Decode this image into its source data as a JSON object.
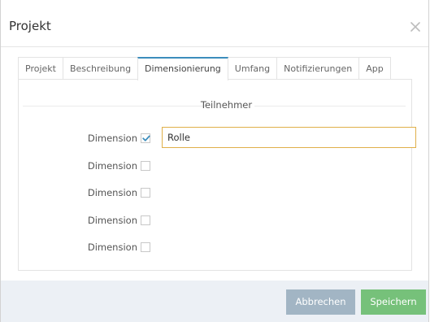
{
  "dialog": {
    "title": "Projekt",
    "close_icon": "close-icon"
  },
  "tabs": [
    {
      "label": "Projekt",
      "active": false
    },
    {
      "label": "Beschreibung",
      "active": false
    },
    {
      "label": "Dimensionierung",
      "active": true
    },
    {
      "label": "Umfang",
      "active": false
    },
    {
      "label": "Notifizierungen",
      "active": false
    },
    {
      "label": "App",
      "active": false
    }
  ],
  "section": {
    "legend": "Teilnehmer"
  },
  "dimensions": [
    {
      "label": "Dimension",
      "checked": true,
      "value": "Rolle"
    },
    {
      "label": "Dimension",
      "checked": false
    },
    {
      "label": "Dimension",
      "checked": false
    },
    {
      "label": "Dimension",
      "checked": false
    },
    {
      "label": "Dimension",
      "checked": false
    }
  ],
  "footer": {
    "cancel_label": "Abbrechen",
    "save_label": "Speichern"
  },
  "colors": {
    "accent": "#3c8dbc",
    "input_focus_border": "#e0b04a",
    "cancel_button": "#a2b5c4",
    "save_button": "#76c17a",
    "footer_bg": "#ecf0f5"
  }
}
